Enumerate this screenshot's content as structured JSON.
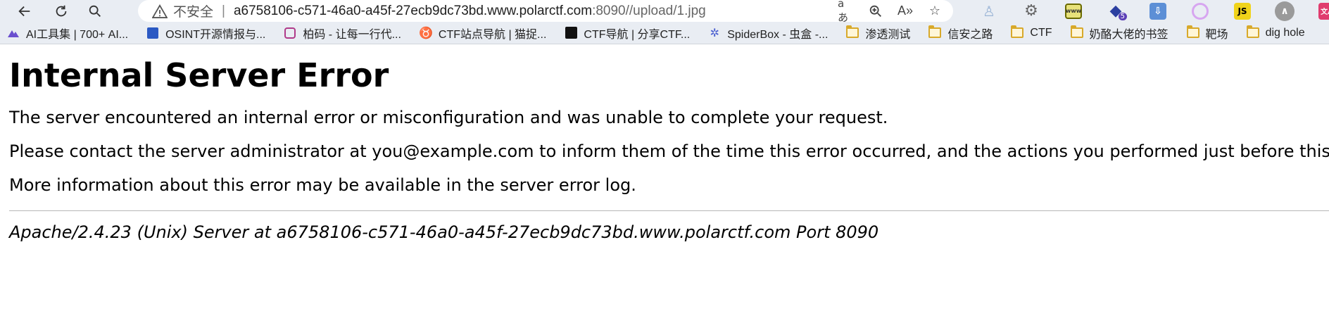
{
  "browser": {
    "security_label": "不安全",
    "separator": "|",
    "url_host": "a6758106-c571-46a0-a45f-27ecb9dc73bd.www.polarctf.com",
    "url_path": ":8090//upload/1.jpg",
    "read_aloud_label": "aあ",
    "ext_js_label": "JS",
    "ext_badge_count": "5",
    "ext_translate_label": "文A"
  },
  "bookmarks": [
    {
      "label": "AI工具集 | 700+ AI...",
      "icon": "ai-tools-icon"
    },
    {
      "label": "OSINT开源情报与...",
      "icon": "osint-icon"
    },
    {
      "label": "柏码 - 让每一行代...",
      "icon": "baima-icon"
    },
    {
      "label": "CTF站点导航 | 猫捉...",
      "icon": "ctf-nav-cat-icon"
    },
    {
      "label": "CTF导航 | 分享CTF...",
      "icon": "ctf-nav-icon"
    },
    {
      "label": "SpiderBox - 虫盒 -...",
      "icon": "spiderbox-icon"
    },
    {
      "label": "渗透测试",
      "icon": "folder-icon"
    },
    {
      "label": "信安之路",
      "icon": "folder-icon"
    },
    {
      "label": "CTF",
      "icon": "folder-icon"
    },
    {
      "label": "奶酪大佬的书签",
      "icon": "folder-icon"
    },
    {
      "label": "靶场",
      "icon": "folder-icon"
    },
    {
      "label": "dig hole",
      "icon": "folder-icon"
    }
  ],
  "page": {
    "title": "Internal Server Error",
    "paragraph1": "The server encountered an internal error or misconfiguration and was unable to complete your request.",
    "paragraph2": "Please contact the server administrator at you@example.com to inform them of the time this error occurred, and the actions you performed just before this error.",
    "paragraph3": "More information about this error may be available in the server error log.",
    "signature": "Apache/2.4.23 (Unix) Server at a6758106-c571-46a0-a45f-27ecb9dc73bd.www.polarctf.com Port 8090"
  }
}
